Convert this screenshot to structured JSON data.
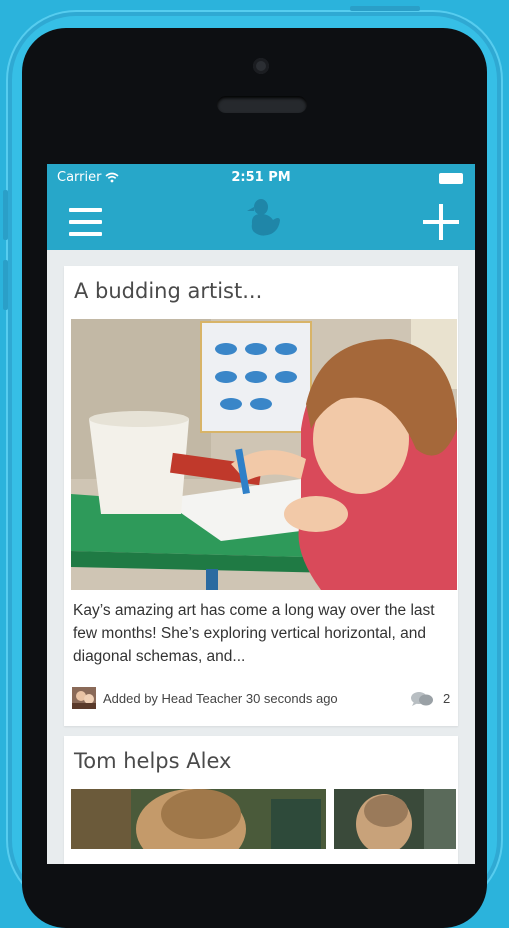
{
  "status_bar": {
    "carrier": "Carrier",
    "time": "2:51 PM"
  },
  "nav": {
    "icons": [
      "menu-icon",
      "duck-logo-icon",
      "plus-icon"
    ]
  },
  "posts": [
    {
      "title": "A budding artist...",
      "body": "Kay’s amazing art has come a long way over the last few months! She’s exploring vertical horizontal, and diagonal schemas, and...",
      "meta": "Added by Head Teacher 30 seconds ago",
      "comment_count": "2"
    },
    {
      "title": "Tom helps Alex"
    }
  ],
  "colors": {
    "phone_body": "#36bfe6",
    "background": "#2bb3dc",
    "nav_bar": "#27a7c9",
    "feed_background": "#e8ecee"
  }
}
